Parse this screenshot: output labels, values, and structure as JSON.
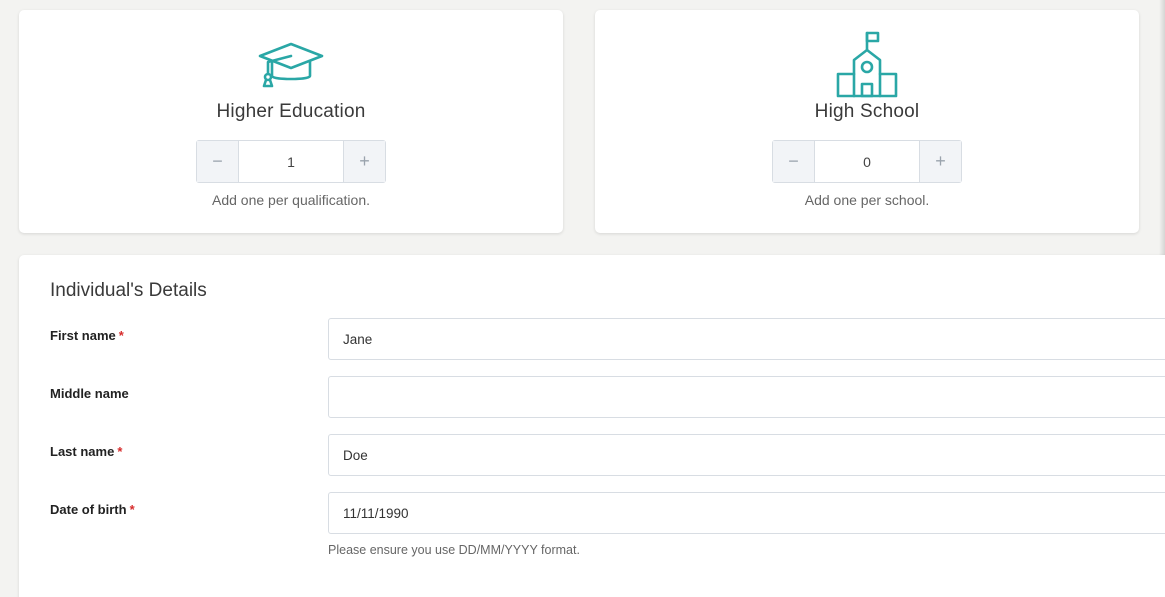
{
  "colors": {
    "accent": "#2aa7a6",
    "required": "#d62b2b",
    "background": "#f3f3f1"
  },
  "higher_education": {
    "icon": "graduation-cap-icon",
    "title": "Higher Education",
    "count": "1",
    "hint": "Add one per qualification."
  },
  "high_school": {
    "icon": "school-building-icon",
    "title": "High School",
    "count": "0",
    "hint": "Add one per school."
  },
  "stepper": {
    "minus": "−",
    "plus": "+"
  },
  "details": {
    "title": "Individual's Details",
    "required_marker": "*",
    "fields": {
      "first_name": {
        "label": "First name",
        "value": "Jane",
        "required": true
      },
      "middle_name": {
        "label": "Middle name",
        "value": "",
        "required": false
      },
      "last_name": {
        "label": "Last name",
        "value": "Doe",
        "required": true
      },
      "dob": {
        "label": "Date of birth",
        "value": "11/11/1990",
        "required": true
      }
    },
    "dob_help": "Please ensure you use DD/MM/YYYY format."
  }
}
